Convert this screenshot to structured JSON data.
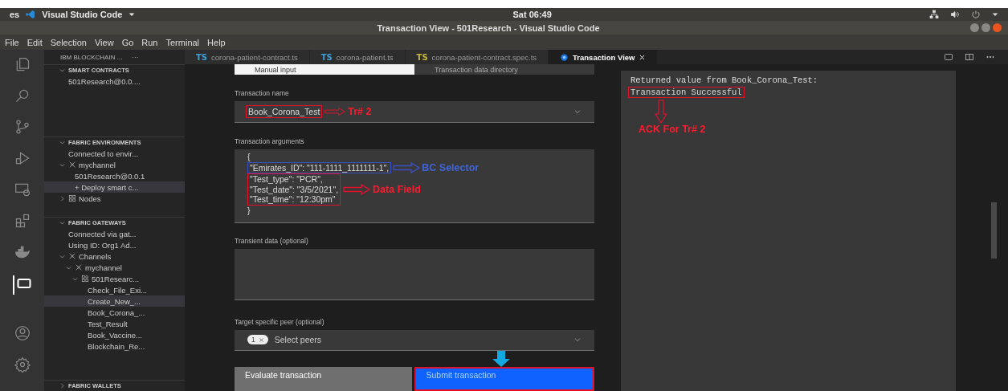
{
  "system_bar": {
    "activities": "es",
    "app_name": "Visual Studio Code",
    "clock": "Sat 06:49"
  },
  "window": {
    "title": "Transaction View - 501Research - Visual Studio Code"
  },
  "menu": [
    "File",
    "Edit",
    "Selection",
    "View",
    "Go",
    "Run",
    "Terminal",
    "Help"
  ],
  "sidebar": {
    "title": "IBM BLOCKCHAIN ...",
    "more": "···",
    "sections": [
      {
        "title": "SMART CONTRACTS",
        "expanded": true,
        "items": [
          {
            "label": "501Research@0.0....",
            "selected": false
          }
        ]
      },
      {
        "title": "FABRIC ENVIRONMENTS",
        "expanded": true,
        "items": [
          {
            "label": "Connected to envir...",
            "selected": false
          },
          {
            "label": "mychannel",
            "kind": "channel",
            "expanded": true,
            "selected": false,
            "children": [
              {
                "label": "501Research@0.0.1",
                "selected": false
              },
              {
                "label": "+ Deploy smart c...",
                "selected": true
              }
            ]
          },
          {
            "label": "Nodes",
            "kind": "nodes",
            "expanded": false,
            "selected": false
          }
        ]
      },
      {
        "title": "FABRIC GATEWAYS",
        "expanded": true,
        "items": [
          {
            "label": "Connected via gat...",
            "selected": false
          },
          {
            "label": "Using ID: Org1 Ad...",
            "selected": false
          },
          {
            "label": "Channels",
            "kind": "channel",
            "expanded": true,
            "selected": false,
            "children": [
              {
                "label": "mychannel",
                "kind": "channel",
                "expanded": true,
                "selected": false,
                "children": [
                  {
                    "label": "501Researc...",
                    "kind": "contract",
                    "expanded": true,
                    "selected": false,
                    "children": [
                      {
                        "label": "Check_File_Exi...",
                        "selected": false
                      },
                      {
                        "label": "Create_New_...",
                        "selected": true
                      },
                      {
                        "label": "Book_Corona_...",
                        "selected": false
                      },
                      {
                        "label": "Test_Result",
                        "selected": false
                      },
                      {
                        "label": "Book_Vaccine...",
                        "selected": false
                      },
                      {
                        "label": "Blockchain_Re...",
                        "selected": false
                      }
                    ]
                  }
                ]
              }
            ]
          }
        ]
      },
      {
        "title": "FABRIC WALLETS",
        "expanded": false
      }
    ]
  },
  "tabs": [
    {
      "kind": "ts",
      "badge": "TS",
      "color": "#3f9fd6",
      "label": "corona-patient-contract.ts",
      "selected": false
    },
    {
      "kind": "ts",
      "badge": "TS",
      "color": "#3f9fd6",
      "label": "corona-patient.ts",
      "selected": false
    },
    {
      "kind": "ts",
      "badge": "TS",
      "color": "#c9b83c",
      "label": "corona-patient-contract.spec.ts",
      "selected": false
    },
    {
      "kind": "webview",
      "label": "Transaction View",
      "selected": true
    }
  ],
  "form": {
    "input_tabs": [
      {
        "label": "Manual input",
        "selected": true
      },
      {
        "label": "Transaction data directory",
        "selected": false
      }
    ],
    "transaction_name": {
      "label": "Transaction name",
      "value": "Book_Corona_Test",
      "note": "Tr# 2"
    },
    "arguments": {
      "label": "Transaction arguments",
      "open": "{",
      "key_line": "\"Emirates_ID\": \"111-1111_1111111-1\",",
      "key_note": "BC Selector",
      "data_lines": [
        "\"Test_type\": \"PCR\",",
        "\"Test_date\": \"3/5/2021\",",
        "\"Test_time\": \"12:30pm\""
      ],
      "data_note": "Data Field",
      "close": "}"
    },
    "transient": {
      "label": "Transient data (optional)"
    },
    "peers": {
      "label": "Target specific peer (optional)",
      "tag": "1",
      "placeholder": "Select peers"
    },
    "buttons": [
      {
        "label": "Evaluate transaction",
        "kind": "secondary"
      },
      {
        "label": "Submit transaction",
        "kind": "primary"
      }
    ]
  },
  "output": {
    "lines": [
      "Returned value from Book_Corona_Test:",
      "Transaction Successful"
    ],
    "note": "ACK For Tr# 2"
  }
}
